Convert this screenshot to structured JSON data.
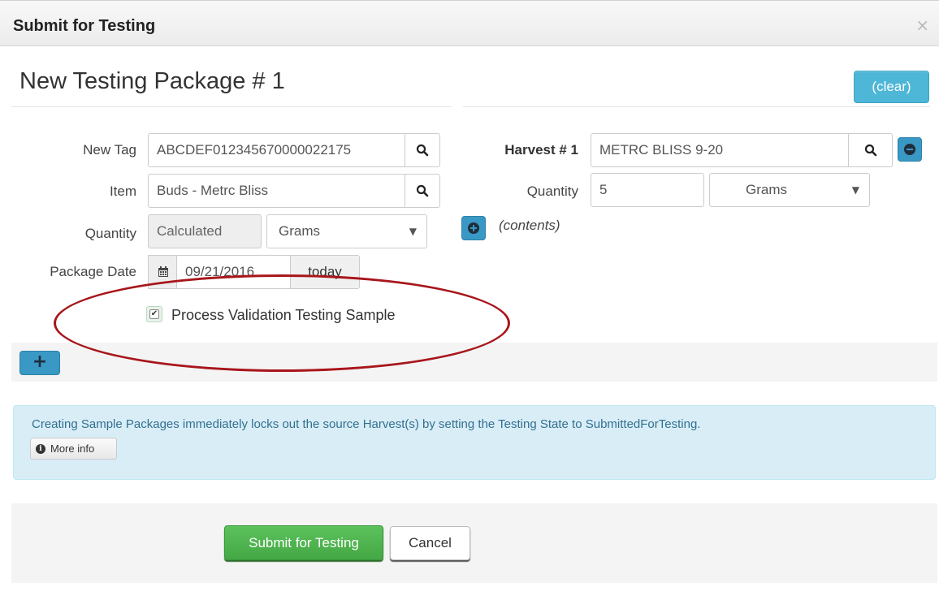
{
  "dialog": {
    "title": "Submit for Testing",
    "close_glyph": "×"
  },
  "package": {
    "title": "New Testing Package # 1",
    "clear_label": "(clear)"
  },
  "left_form": {
    "new_tag_label": "New Tag",
    "new_tag_value": "ABCDEF012345670000022175",
    "item_label": "Item",
    "item_value": "Buds - Metrc Bliss",
    "quantity_label": "Quantity",
    "quantity_value": "Calculated",
    "quantity_unit": "Grams",
    "package_date_label": "Package Date",
    "package_date_value": "09/21/2016",
    "today_label": "today",
    "pv_checkbox_checked": true,
    "pv_checkbox_label": "Process Validation Testing Sample"
  },
  "right_form": {
    "harvest_label": "Harvest # 1",
    "harvest_value": "METRC BLISS 9-20",
    "quantity_label": "Quantity",
    "quantity_value": "5",
    "quantity_unit": "Grams",
    "contents_label": "(contents)"
  },
  "info": {
    "message": "Creating Sample Packages immediately locks out the source Harvest(s) by setting the Testing State to SubmittedForTesting.",
    "more_info_label": "More info"
  },
  "footer": {
    "submit_label": "Submit for Testing",
    "cancel_label": "Cancel"
  },
  "icons": {
    "search": "search-icon",
    "calendar": "calendar-icon",
    "remove": "minus-circle-icon",
    "add_contents": "plus-circle-icon",
    "add_package": "plus-icon",
    "info": "info-circle-icon",
    "close": "close-icon"
  },
  "colors": {
    "info_button": "#3a98c4",
    "clear_button": "#4eb6d6",
    "submit_button": "#4cae4c",
    "info_box_bg": "#d9edf7",
    "info_text": "#31708f",
    "annotation_ellipse": "#a8161b"
  }
}
